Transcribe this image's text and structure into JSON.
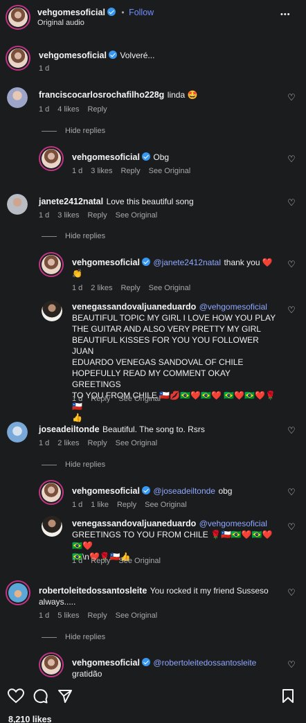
{
  "header": {
    "username": "vehgomesoficial",
    "dot": "•",
    "follow_label": "Follow",
    "audio": "Original audio",
    "more": "•••"
  },
  "caption": {
    "username": "vehgomesoficial",
    "text": "Volveré...",
    "time": "1 d"
  },
  "comments": [
    {
      "username": "franciscocarlosrochafilho228g",
      "text": "linda 🤩",
      "time": "1 d",
      "likes": "4 likes",
      "reply": "Reply"
    },
    {
      "username": "janete2412natal",
      "text": "Love this beautiful song",
      "time": "1 d",
      "likes": "3 likes",
      "reply": "Reply",
      "see_original": "See Original"
    },
    {
      "username": "joseadeiltonde",
      "text": "Beautiful. The song to. Rsrs",
      "time": "1 d",
      "likes": "2 likes",
      "reply": "Reply",
      "see_original": "See Original"
    },
    {
      "username": "robertoleitedossantosleite",
      "text_line1": "You rocked it my friend Susseso",
      "text_line2": "always.....",
      "time": "1 d",
      "likes": "5 likes",
      "reply": "Reply",
      "see_original": "See Original"
    }
  ],
  "hide_replies_label": "Hide replies",
  "replies": [
    {
      "username": "vehgomesoficial",
      "text": "Obg",
      "time": "1 d",
      "likes": "3 likes",
      "reply": "Reply",
      "see_original": "See Original"
    },
    {
      "username": "vehgomesoficial",
      "mention": "@janete2412natal",
      "text": "thank you ❤️",
      "text_line2": "👏",
      "time": "1 d",
      "likes": "2 likes",
      "reply": "Reply",
      "see_original": "See Original"
    },
    {
      "username": "venegassandovaljuaneduardo",
      "mention": "@vehgomesoficial",
      "lines": [
        "BEAUTIFUL TOPIC MY GIRL I LOVE HOW YOU PLAY",
        "THE GUITAR AND ALSO VERY PRETTY MY GIRL",
        "BEAUTIFUL KISSES FOR YOU YOU FOLLOWER JUAN",
        "EDUARDO VENEGAS SANDOVAL OF CHILE",
        "HOPEFULLY READ MY COMMENT OKAY GREETINGS",
        "TO YOU FROM CHILE 🇨🇱💋🇧🇷❤️🇧🇷❤️ 🇧🇷❤️🇧🇷❤️🌹🇨🇱",
        "👍"
      ],
      "time": "1 d",
      "reply": "Reply",
      "see_original": "See Original"
    },
    {
      "username": "vehgomesoficial",
      "mention": "@joseadeiltonde",
      "text": "obg",
      "time": "1 d",
      "likes": "1 like",
      "reply": "Reply",
      "see_original": "See Original"
    },
    {
      "username": "venegassandovaljuaneduardo",
      "mention": "@vehgomesoficial",
      "lines": [
        "GREETINGS TO YOU FROM CHILE 🌹🇨🇱🇧🇷❤️🇧🇷❤️ 🇧🇷❤️",
        "🇧🇷\\n❤️🌹🇨🇱👍"
      ],
      "time": "1 d",
      "reply": "Reply",
      "see_original": "See Original"
    },
    {
      "username": "vehgomesoficial",
      "mention": "@robertoleitedossantosleite",
      "text": "gratidão"
    }
  ],
  "footer": {
    "likes": "8,210 likes"
  },
  "colors": {
    "background": "#1b1c1e",
    "mention": "#8fa8ff",
    "follow": "#6f8fff",
    "verified": "#3897f0"
  }
}
